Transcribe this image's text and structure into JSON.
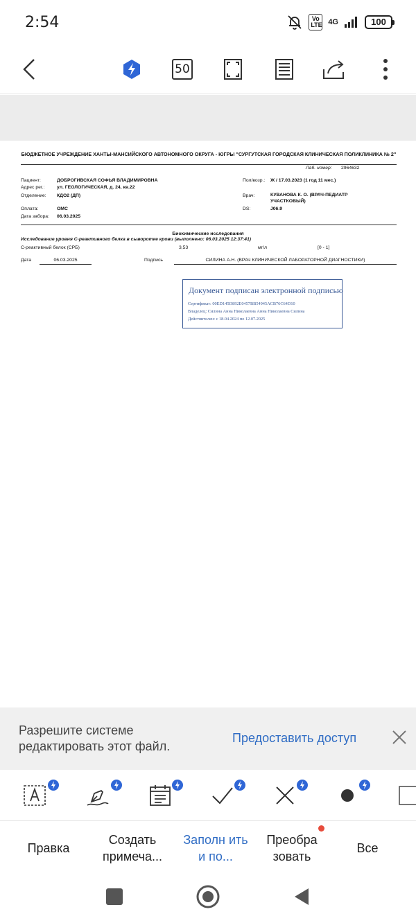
{
  "status_bar": {
    "time": "2:54",
    "volte": "Vo LTE",
    "network": "4G",
    "battery": "100"
  },
  "toolbar": {
    "page_count": "50"
  },
  "document": {
    "org_header": "БЮДЖЕТНОЕ УЧРЕЖДЕНИЕ ХАНТЫ-МАНСИЙСКОГО АВТОНОМНОГО ОКРУГА - ЮГРЫ \"СУРГУТСКАЯ ГОРОДСКАЯ КЛИНИЧЕСКАЯ ПОЛИКЛИНИКА № 2\"",
    "lab_number_label": "Лаб. номер:",
    "lab_number": "2964632",
    "patient_label": "Пациент:",
    "patient": "ДОБРОГИВСКАЯ СОФЬЯ ВЛАДИМИРОВНА",
    "sex_age_label": "Пол/возр.:",
    "sex_age": "Ж / 17.03.2023 (1 год 11 мес.)",
    "address_label": "Адрес рег.:",
    "address": "ул. ГЕОЛОГИЧЕСКАЯ, д. 24, кв.22",
    "department_label": "Отделение:",
    "department": "КДО2 (ДП)",
    "doctor_label": "Врач:",
    "doctor_line1": "КУВАНОВА К. О. (ВРАЧ-ПЕДИАТР",
    "doctor_line2": "УЧАСТКОВЫЙ)",
    "payment_label": "Оплата:",
    "payment": "ОМС",
    "ds_label": "DS:",
    "ds": "J06.9",
    "collection_date_label": "Дата забора:",
    "collection_date": "06.03.2025",
    "section_title": "Биохимические исследования",
    "study_title": "Исследование уровня С-реактивного белка в сыворотке крови (выполнено: 06.03.2025 12:37:41)",
    "result": {
      "name": "С-реактивный белок (СРБ)",
      "value": "3,53",
      "unit": "мг/л",
      "reference": "[0 - 1]"
    },
    "date_label": "Дата",
    "date_value": "06.03.2025",
    "signature_label": "Подпись",
    "signature_value": "СИЛИНА А.Н. (ВРАЧ КЛИНИЧЕСКОЙ ЛАБОРАТОРНОЙ ДИАГНОСТИКИ)",
    "stamp": {
      "title": "Документ подписан электронной подписью",
      "certificate": "Сертификат: 00ED145D892E0457BB54945ACB76C64D10",
      "owner": "Владелец: Силина Анна Николаевна Анна Николаевна Силина",
      "validity": "Действителен: с 18.04.2024 по 12.07.2025"
    }
  },
  "permission_banner": {
    "message": "Разрешите системе редактировать этот файл.",
    "action": "Предоставить доступ"
  },
  "tabs": [
    {
      "label": "Правка"
    },
    {
      "label": "Создать примеча..."
    },
    {
      "label": "Заполн ить и по..."
    },
    {
      "label": "Преобра зовать"
    },
    {
      "label": "Все"
    }
  ],
  "colors": {
    "accent": "#2f6cc4",
    "badge": "#2f66d6",
    "stamp": "#3a5a96",
    "red_dot": "#e74c3c"
  }
}
